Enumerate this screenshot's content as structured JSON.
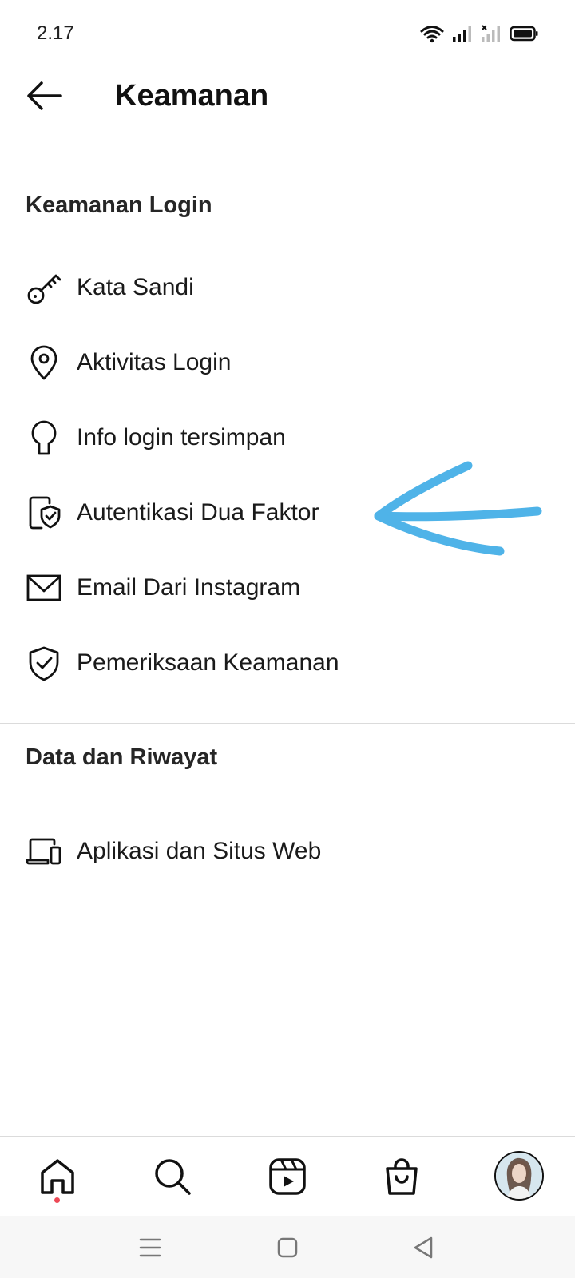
{
  "status_bar": {
    "time": "2.17"
  },
  "header": {
    "title": "Keamanan",
    "back_icon": "arrow-left-icon"
  },
  "sections": [
    {
      "title": "Keamanan Login",
      "items": [
        {
          "label": "Kata Sandi",
          "icon": "key-icon"
        },
        {
          "label": "Aktivitas Login",
          "icon": "location-pin-icon"
        },
        {
          "label": "Info login tersimpan",
          "icon": "keyhole-icon"
        },
        {
          "label": "Autentikasi Dua Faktor",
          "icon": "phone-shield-icon"
        },
        {
          "label": "Email Dari Instagram",
          "icon": "envelope-icon"
        },
        {
          "label": "Pemeriksaan Keamanan",
          "icon": "shield-check-icon"
        }
      ]
    },
    {
      "title": "Data dan Riwayat",
      "items": [
        {
          "label": "Aplikasi dan Situs Web",
          "icon": "laptop-phone-icon"
        }
      ]
    }
  ],
  "annotation": {
    "color": "#4fb3e8",
    "points_to": "Autentikasi Dua Faktor"
  },
  "bottom_nav": {
    "items": [
      "home-icon",
      "search-icon",
      "reels-icon",
      "shop-icon",
      "profile-avatar"
    ],
    "notification_dot_color": "#ed4956"
  },
  "system_nav": {
    "items": [
      "menu-icon",
      "home-square-icon",
      "back-triangle-icon"
    ]
  }
}
